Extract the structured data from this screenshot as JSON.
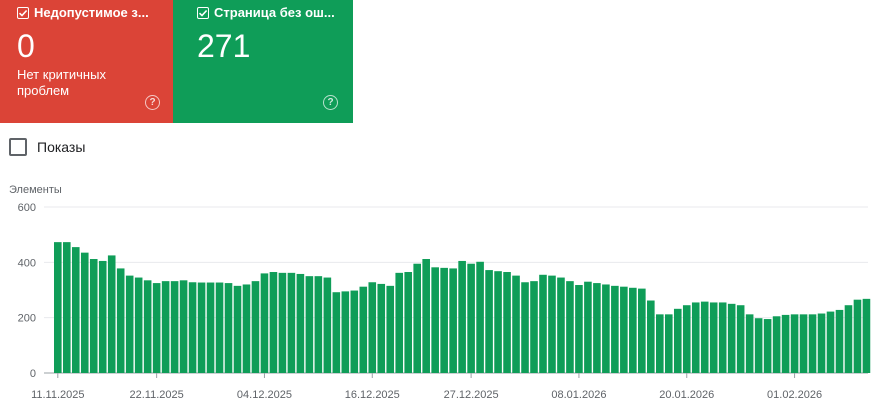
{
  "cards": [
    {
      "title": "Недопустимое з...",
      "value": "0",
      "subtitle": "Нет критичных проблем",
      "checked": true,
      "color": "#db4437",
      "help_icon": "question-circle-icon"
    },
    {
      "title": "Страница без ош...",
      "value": "271",
      "subtitle": "",
      "checked": true,
      "color": "#0f9d58",
      "help_icon": "question-circle-icon"
    }
  ],
  "impressions_label": "Показы",
  "chart_data": {
    "type": "bar",
    "ylabel": "Элементы",
    "ylim": [
      0,
      600
    ],
    "yticks": [
      0,
      200,
      400,
      600
    ],
    "bar_color": "#0f9d58",
    "xtick_labels": [
      "11.11.2025",
      "22.11.2025",
      "04.12.2025",
      "16.12.2025",
      "27.12.2025",
      "08.01.2026",
      "20.01.2026",
      "01.02.2026"
    ],
    "first_date": "11.11.2025",
    "values": [
      473,
      473,
      455,
      435,
      412,
      405,
      425,
      378,
      352,
      345,
      335,
      325,
      332,
      332,
      335,
      328,
      327,
      327,
      327,
      325,
      315,
      320,
      332,
      360,
      365,
      362,
      362,
      358,
      350,
      350,
      345,
      292,
      295,
      298,
      312,
      328,
      322,
      315,
      362,
      365,
      395,
      412,
      382,
      380,
      378,
      405,
      395,
      402,
      372,
      368,
      365,
      352,
      328,
      332,
      355,
      352,
      345,
      332,
      318,
      330,
      325,
      320,
      315,
      312,
      308,
      305,
      262,
      212,
      212,
      232,
      245,
      255,
      258,
      255,
      255,
      250,
      245,
      212,
      198,
      195,
      205,
      210,
      212,
      212,
      212,
      215,
      222,
      228,
      245,
      265,
      268
    ]
  }
}
